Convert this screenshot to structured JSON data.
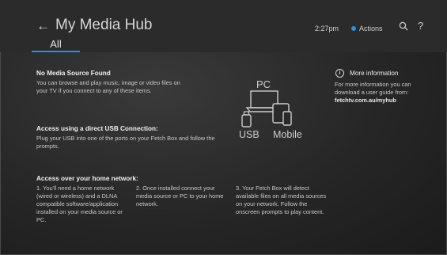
{
  "header": {
    "back_glyph": "←",
    "title": "My Media Hub",
    "tab": "All",
    "time": "2:27pm",
    "actions_label": "Actions",
    "help_glyph": "?"
  },
  "content": {
    "no_source": {
      "heading": "No Media Source Found",
      "body": "You can browse and play music, image or video files on your TV if you connect to any of these items."
    },
    "usb": {
      "heading": "Access using a direct USB Connection:",
      "body": "Plug your USB into one of the ports on your Fetch Box and follow the prompts."
    },
    "network": {
      "heading": "Access over your home network:",
      "step1": "1. You'll need a home network (wired or wireless) and a DLNA compatible software/application installed on your media source or PC.",
      "step2": "2. Once installed connect your media source or PC to your home network.",
      "step3": "3. Your Fetch Box will detect available files on all media sources on your network. Follow the onscreen prompts to play content."
    },
    "devices": {
      "pc": "PC",
      "usb": "USB",
      "mobile": "Mobile"
    },
    "more_info": {
      "icon_glyph": "i",
      "title": "More information",
      "body": "For more information you can download a user guide from:",
      "link": "fetchtv.com.au/myhub"
    }
  },
  "colors": {
    "accent": "#2a8fe0",
    "header_bg": "#2b2b2b"
  },
  "icons": [
    "back-arrow-icon",
    "search-icon",
    "help-icon",
    "info-icon",
    "devices-illustration-icon"
  ]
}
